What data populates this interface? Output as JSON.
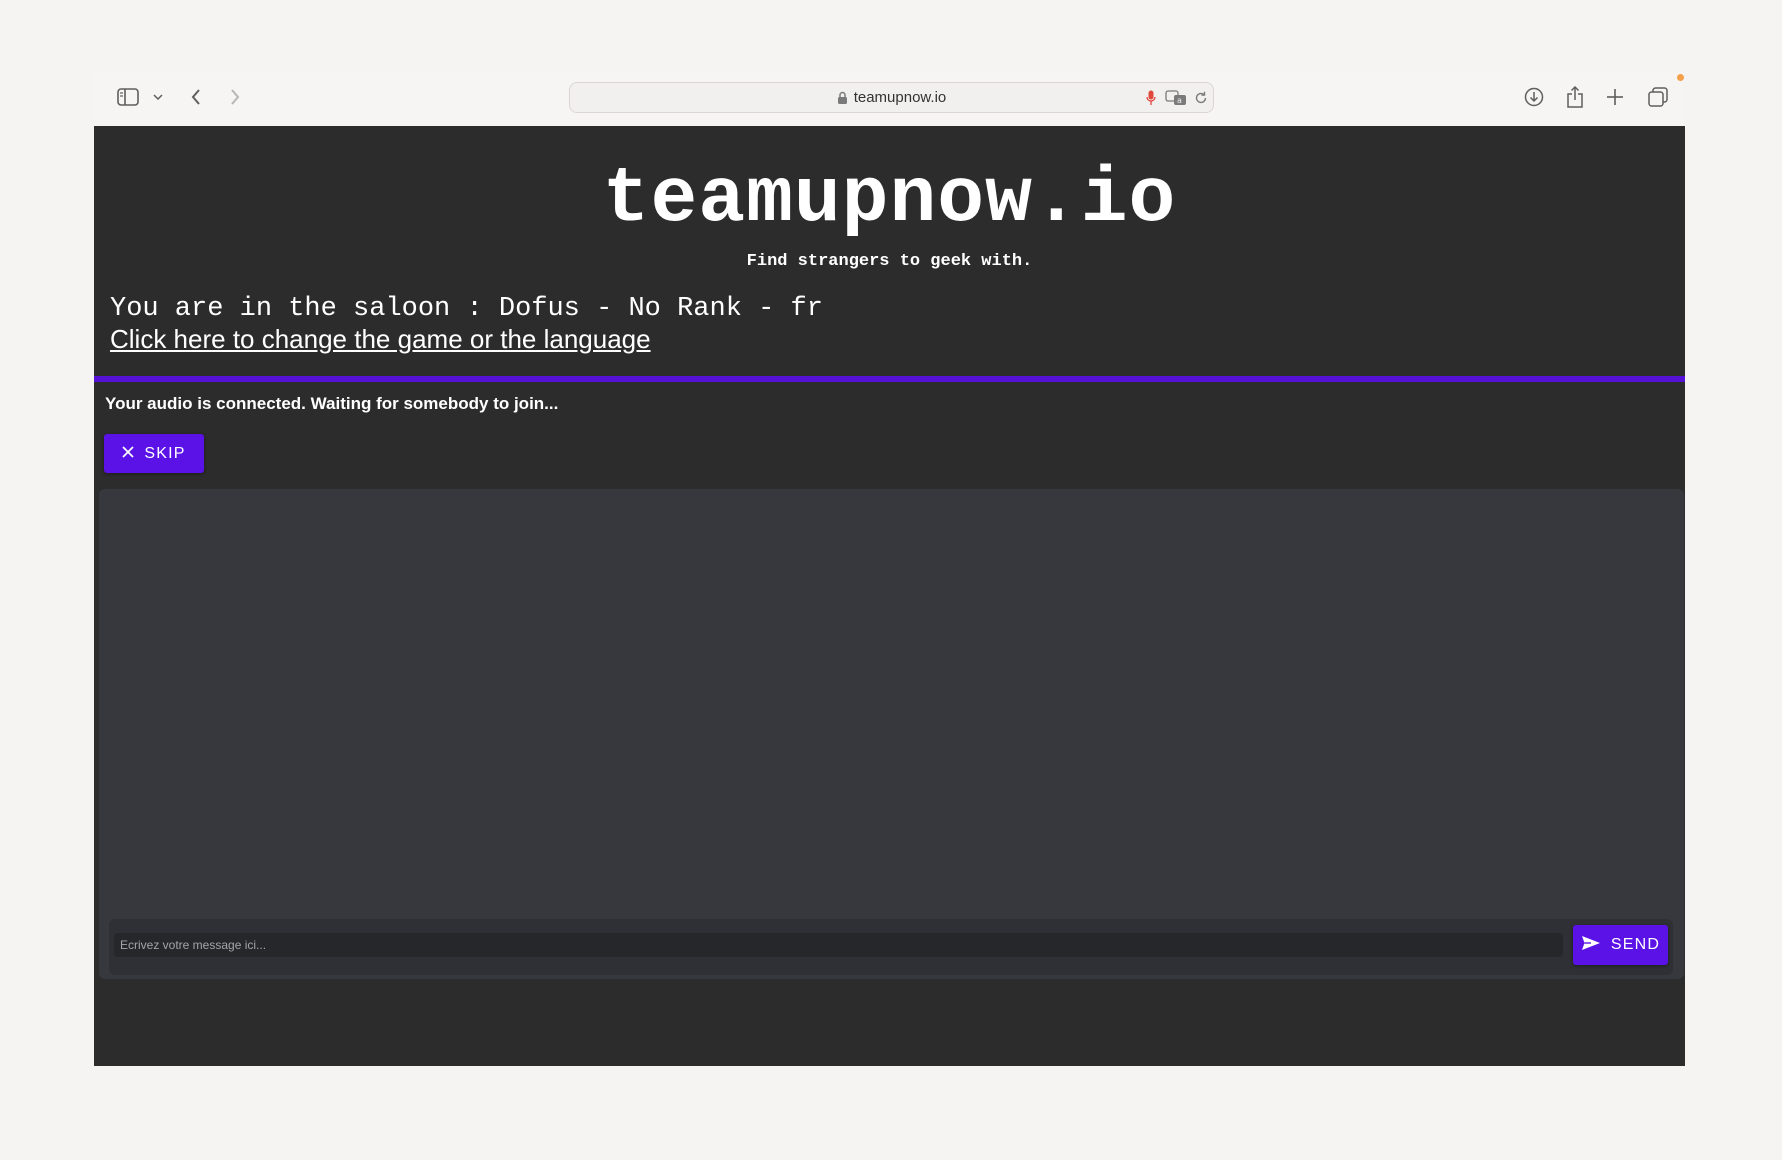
{
  "browser": {
    "address": "teamupnow.io",
    "icons": {
      "sidebar": "sidebar-icon",
      "sidebar_menu": "chevron-down-icon",
      "back": "chevron-left-icon",
      "forward": "chevron-right-icon",
      "lock": "lock-icon",
      "microphone": "microphone-icon",
      "translate": "translate-icon",
      "reload": "reload-icon",
      "downloads": "download-icon",
      "share": "share-icon",
      "new_tab": "plus-icon",
      "tab_overview": "tabs-icon"
    },
    "notification_color": "#f5a04a"
  },
  "page": {
    "title": "teamupnow.io",
    "tagline": "Find strangers to geek with.",
    "saloon": "You are in the saloon : Dofus - No Rank - fr",
    "change_link": "Click here to change the game or the language",
    "status": "Your audio is connected. Waiting for somebody to join...",
    "skip_label": "SKIP",
    "chat": {
      "input_placeholder": "Ecrivez votre message ici...",
      "input_value": "",
      "send_label": "SEND"
    }
  },
  "colors": {
    "accent": "#5b12e6",
    "page_background": "#2c2c2c",
    "chat_panel": "#37383d"
  }
}
